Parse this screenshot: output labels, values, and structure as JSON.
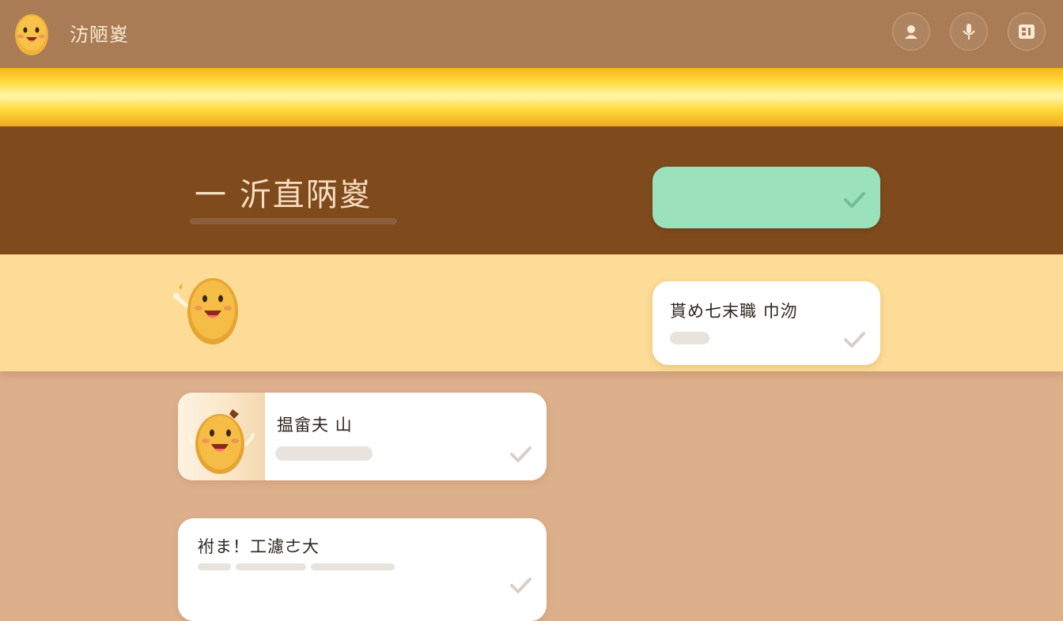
{
  "header": {
    "app_title": "汸陋嵏",
    "icons": [
      "user-icon",
      "microphone-icon",
      "card-icon"
    ]
  },
  "section": {
    "title": "一 沂直陃嵏"
  },
  "cards": [
    {
      "label": "貰め七末職 巾沕"
    },
    {
      "label": "揾畲夫 山"
    },
    {
      "label": "袝ま！工濾ㄜ大"
    }
  ],
  "colors": {
    "header_bg": "#a97c55",
    "glow": "#ffd93a",
    "brown_band": "#7f4a1c",
    "cream_band": "#fcdc96",
    "page_bg": "#ddb08c",
    "accent_green": "#9be2bc",
    "mascot": "#f2b23a"
  }
}
